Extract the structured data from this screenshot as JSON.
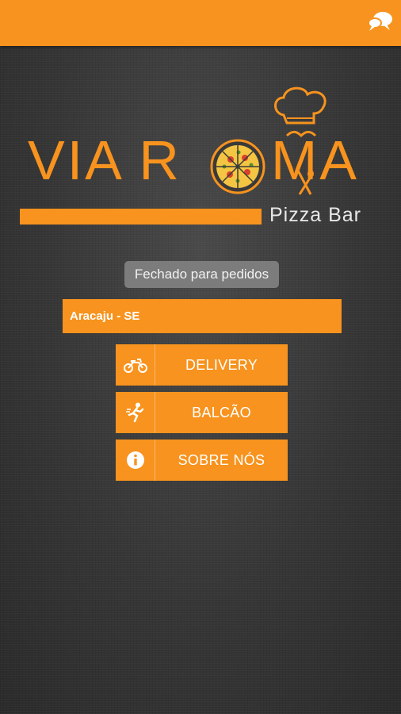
{
  "header": {
    "chat_icon": "chat-bubbles-icon"
  },
  "logo": {
    "word_left": "VIA R",
    "word_right": "MA",
    "subtitle": "Pizza Bar"
  },
  "status": {
    "text": "Fechado para pedidos"
  },
  "city": {
    "selected": "Aracaju - SE"
  },
  "menu": {
    "delivery": {
      "label": "DELIVERY",
      "icon": "motorcycle-icon"
    },
    "balcao": {
      "label": "BALCÃO",
      "icon": "running-person-icon"
    },
    "sobre": {
      "label": "SOBRE NÓS",
      "icon": "info-icon"
    }
  },
  "colors": {
    "accent": "#f7931e",
    "badge": "#7c7c7c",
    "background": "#3a3a3a"
  }
}
